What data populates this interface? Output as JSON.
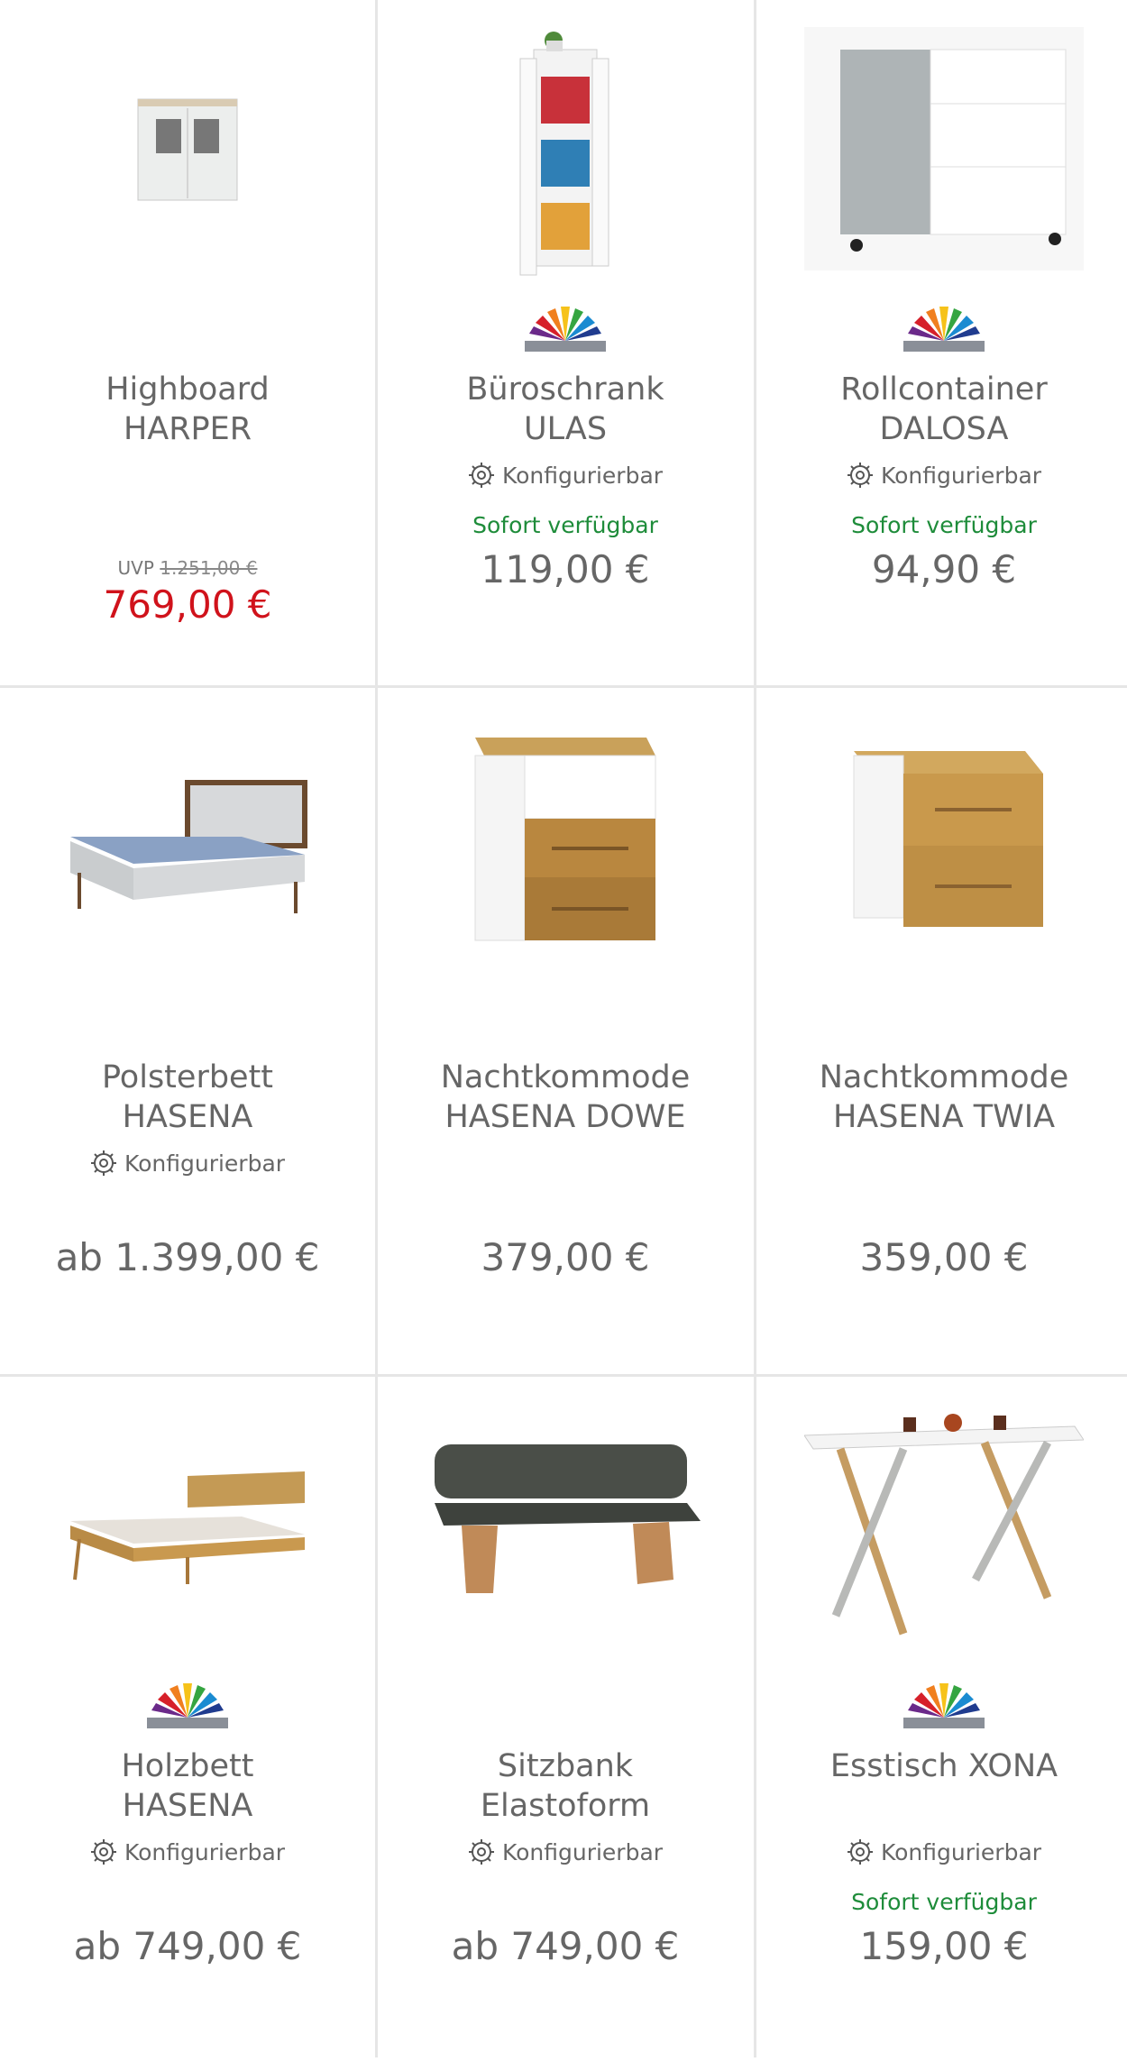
{
  "products": [
    {
      "title_line1": "Highboard",
      "title_line2": "HARPER",
      "uvp_label": "UVP",
      "uvp_value": "1.251,00 €",
      "price": "769,00 €",
      "image": "highboard-image"
    },
    {
      "title_line1": "Büroschrank",
      "title_line2": "ULAS",
      "config": "Konfigurierbar",
      "availability": "Sofort verfügbar",
      "price": "119,00 €",
      "image": "cabinet-image"
    },
    {
      "title_line1": "Rollcontainer",
      "title_line2": "DALOSA",
      "config": "Konfigurierbar",
      "availability": "Sofort verfügbar",
      "price": "94,90 €",
      "image": "rolling-container-image"
    },
    {
      "title_line1": "Polsterbett",
      "title_line2": "HASENA",
      "config": "Konfigurierbar",
      "price": "ab 1.399,00 €",
      "image": "upholstered-bed-image"
    },
    {
      "title_line1": "Nachtkommode",
      "title_line2": "HASENA DOWE",
      "price": "379,00 €",
      "image": "nightstand-image"
    },
    {
      "title_line1": "Nachtkommode",
      "title_line2": "HASENA TWIA",
      "price": "359,00 €",
      "image": "nightstand-image"
    },
    {
      "title_line1": "Holzbett",
      "title_line2": "HASENA",
      "config": "Konfigurierbar",
      "price": "ab 749,00 €",
      "image": "wooden-bed-image"
    },
    {
      "title_line1": "Sitzbank",
      "title_line2": "Elastoform",
      "config": "Konfigurierbar",
      "price": "ab 749,00 €",
      "image": "bench-image"
    },
    {
      "title_line1": "Esstisch XONA",
      "title_line2": "",
      "config": "Konfigurierbar",
      "availability": "Sofort verfügbar",
      "price": "159,00 €",
      "image": "dining-table-image"
    }
  ],
  "colors": {
    "sale": "#d0121b",
    "available": "#1e8c3a",
    "text": "#666666"
  },
  "icons": {
    "config": "gear-icon",
    "color_options": "color-fan-icon"
  }
}
